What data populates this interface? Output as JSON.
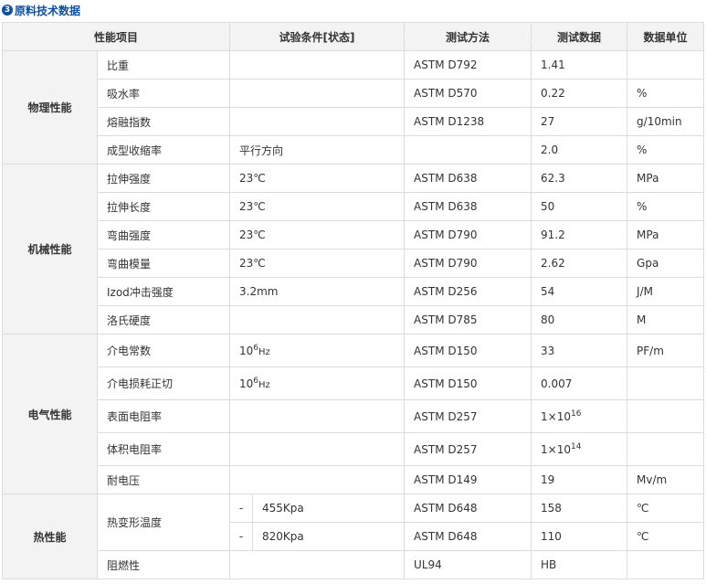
{
  "title": "原料技术数据",
  "headers": {
    "item": "性能项目",
    "condition": "试验条件[状态]",
    "method": "测试方法",
    "data": "测试数据",
    "unit": "数据单位"
  },
  "categories": {
    "physical": "物理性能",
    "mechanical": "机械性能",
    "electrical": "电气性能",
    "thermal": "热性能"
  },
  "rows": [
    {
      "item": "比重",
      "condition": "",
      "method": "ASTM D792",
      "data": "1.41",
      "unit": ""
    },
    {
      "item": "吸水率",
      "condition": "",
      "method": "ASTM D570",
      "data": "0.22",
      "unit": "%"
    },
    {
      "item": "熔融指数",
      "condition": "",
      "method": "ASTM D1238",
      "data": "27",
      "unit": "g/10min"
    },
    {
      "item": "成型收缩率",
      "condition": "平行方向",
      "method": "",
      "data": "2.0",
      "unit": "%"
    },
    {
      "item": "拉伸强度",
      "condition": "23℃",
      "method": "ASTM D638",
      "data": "62.3",
      "unit": "MPa"
    },
    {
      "item": "拉伸长度",
      "condition": "23℃",
      "method": "ASTM D638",
      "data": "50",
      "unit": "%"
    },
    {
      "item": "弯曲强度",
      "condition": "23℃",
      "method": "ASTM D790",
      "data": "91.2",
      "unit": "MPa"
    },
    {
      "item": "弯曲模量",
      "condition": "23℃",
      "method": "ASTM D790",
      "data": "2.62",
      "unit": "Gpa"
    },
    {
      "item": "Izod冲击强度",
      "condition": "3.2mm",
      "method": "ASTM D256",
      "data": "54",
      "unit": "J/M"
    },
    {
      "item": "洛氏硬度",
      "condition": "",
      "method": "ASTM D785",
      "data": "80",
      "unit": "M"
    },
    {
      "item": "介电常数",
      "condition_base": "10",
      "condition_exp": "6",
      "condition_unit": "Hz",
      "method": "ASTM D150",
      "data": "33",
      "unit": "PF/m"
    },
    {
      "item": "介电损耗正切",
      "condition_base": "10",
      "condition_exp": "6",
      "condition_unit": "Hz",
      "method": "ASTM D150",
      "data": "0.007",
      "unit": ""
    },
    {
      "item": "表面电阻率",
      "condition": "",
      "method": "ASTM D257",
      "data_base": "1×10",
      "data_exp": "16",
      "unit": ""
    },
    {
      "item": "体积电阻率",
      "condition": "",
      "method": "ASTM D257",
      "data_base": "1×10",
      "data_exp": "14",
      "unit": ""
    },
    {
      "item": "耐电压",
      "condition": "",
      "method": "ASTM D149",
      "data": "19",
      "unit": "Mv/m"
    },
    {
      "item": "热变形温度",
      "dash": "-",
      "condition": "455Kpa",
      "method": "ASTM D648",
      "data": "158",
      "unit": "℃"
    },
    {
      "dash": "-",
      "condition": "820Kpa",
      "method": "ASTM D648",
      "data": "110",
      "unit": "℃"
    },
    {
      "item": "阻燃性",
      "condition": "",
      "method": "UL94",
      "data": "HB",
      "unit": ""
    }
  ]
}
